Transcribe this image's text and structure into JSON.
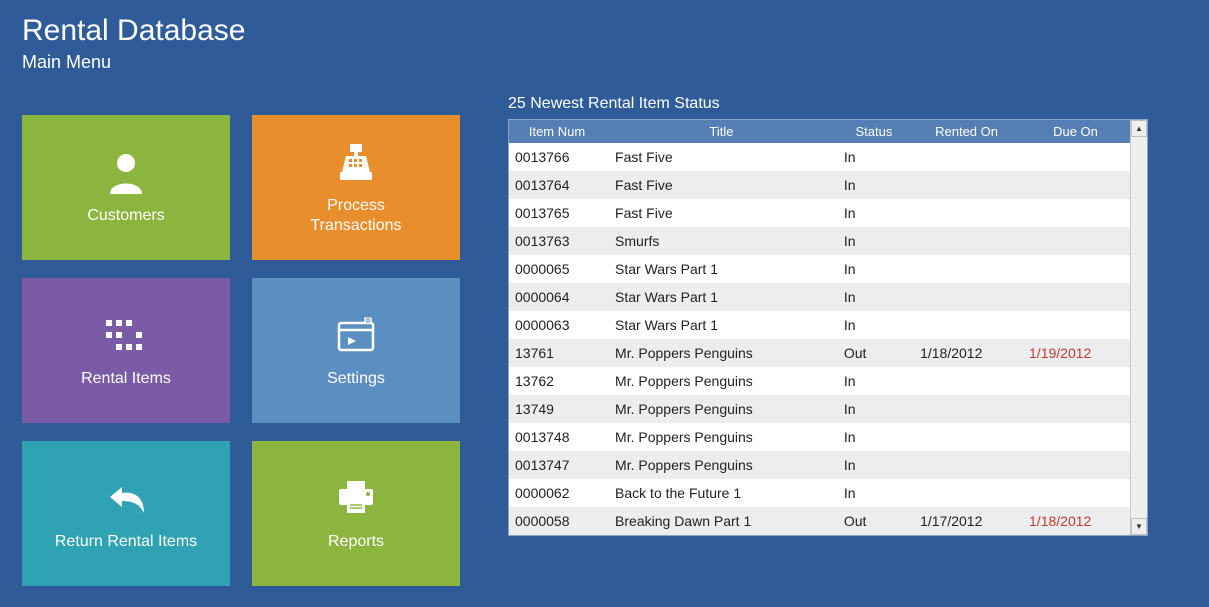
{
  "header": {
    "title": "Rental Database",
    "subtitle": "Main Menu"
  },
  "tiles": {
    "customers": "Customers",
    "process_transactions": "Process\nTransactions",
    "rental_items": "Rental Items",
    "settings": "Settings",
    "return_rental_items": "Return Rental Items",
    "reports": "Reports"
  },
  "panel": {
    "title": "25 Newest Rental Item Status",
    "columns": {
      "item_num": "Item Num",
      "title": "Title",
      "status": "Status",
      "rented_on": "Rented On",
      "due_on": "Due On"
    },
    "rows": [
      {
        "item_num": "0013766",
        "title": "Fast Five",
        "status": "In",
        "rented_on": "",
        "due_on": "",
        "overdue": false
      },
      {
        "item_num": "0013764",
        "title": "Fast Five",
        "status": "In",
        "rented_on": "",
        "due_on": "",
        "overdue": false
      },
      {
        "item_num": "0013765",
        "title": "Fast Five",
        "status": "In",
        "rented_on": "",
        "due_on": "",
        "overdue": false
      },
      {
        "item_num": "0013763",
        "title": "Smurfs",
        "status": "In",
        "rented_on": "",
        "due_on": "",
        "overdue": false
      },
      {
        "item_num": "0000065",
        "title": "Star Wars Part 1",
        "status": "In",
        "rented_on": "",
        "due_on": "",
        "overdue": false
      },
      {
        "item_num": "0000064",
        "title": "Star Wars Part 1",
        "status": "In",
        "rented_on": "",
        "due_on": "",
        "overdue": false
      },
      {
        "item_num": "0000063",
        "title": "Star Wars Part 1",
        "status": "In",
        "rented_on": "",
        "due_on": "",
        "overdue": false
      },
      {
        "item_num": "13761",
        "title": "Mr. Poppers Penguins",
        "status": "Out",
        "rented_on": "1/18/2012",
        "due_on": "1/19/2012",
        "overdue": true
      },
      {
        "item_num": "13762",
        "title": "Mr. Poppers Penguins",
        "status": "In",
        "rented_on": "",
        "due_on": "",
        "overdue": false
      },
      {
        "item_num": "13749",
        "title": "Mr. Poppers Penguins",
        "status": "In",
        "rented_on": "",
        "due_on": "",
        "overdue": false
      },
      {
        "item_num": "0013748",
        "title": "Mr. Poppers Penguins",
        "status": "In",
        "rented_on": "",
        "due_on": "",
        "overdue": false
      },
      {
        "item_num": "0013747",
        "title": "Mr. Poppers Penguins",
        "status": "In",
        "rented_on": "",
        "due_on": "",
        "overdue": false
      },
      {
        "item_num": "0000062",
        "title": "Back to the Future 1",
        "status": "In",
        "rented_on": "",
        "due_on": "",
        "overdue": false
      },
      {
        "item_num": "0000058",
        "title": "Breaking Dawn Part 1",
        "status": "Out",
        "rented_on": "1/17/2012",
        "due_on": "1/18/2012",
        "overdue": true
      }
    ]
  }
}
